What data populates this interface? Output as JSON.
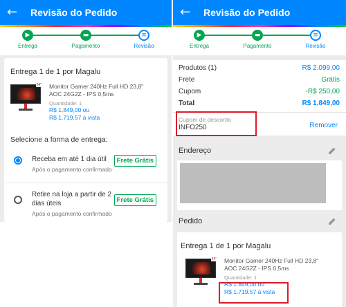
{
  "left": {
    "appbar": {
      "back": "←",
      "title": "Revisão do Pedido"
    },
    "steps": [
      {
        "label": "Entrega",
        "icon": "truck-icon",
        "status": "done"
      },
      {
        "label": "Pagamento",
        "icon": "payment-icon",
        "status": "done"
      },
      {
        "label": "Revisão",
        "icon": "review-icon",
        "status": "current"
      }
    ],
    "delivery_title": "Entrega 1 de 1 por Magalu",
    "product": {
      "name_line1": "Monitor Gamer 240Hz Full HD 23,8\"",
      "name_line2": "AOC 24G2Z - IPS 0,5ms",
      "quantity": "Quantidade: 1",
      "price_installment": "R$ 1.849,00 ou",
      "price_cash": "R$ 1.719,57 à vista"
    },
    "shipping_heading": "Selecione a forma de entrega:",
    "options": [
      {
        "title": "Receba em até 1 dia útil",
        "subtitle": "Após o pagamento confirmado",
        "tag": "Frete Grátis",
        "selected": true
      },
      {
        "title_line1": "Retire na loja a partir de 2",
        "title_line2": "dias úteis",
        "subtitle": "Após o pagamento confirmado",
        "tag": "Frete Grátis",
        "selected": false
      }
    ]
  },
  "right": {
    "appbar": {
      "back": "←",
      "title": "Revisão do Pedido"
    },
    "steps": [
      {
        "label": "Entrega",
        "icon": "truck-icon",
        "status": "done"
      },
      {
        "label": "Pagamento",
        "icon": "payment-icon",
        "status": "done"
      },
      {
        "label": "Revisão",
        "icon": "review-icon",
        "status": "current"
      }
    ],
    "summary": {
      "products_label": "Produtos (1)",
      "products_value": "R$ 2.099,00",
      "shipping_label": "Frete",
      "shipping_value": "Grátis",
      "coupon_label": "Cupom",
      "coupon_value": "-R$ 250,00",
      "total_label": "Total",
      "total_value": "R$ 1.849,00"
    },
    "coupon": {
      "field_label": "Cupom de desconto",
      "code": "INFO250",
      "remove": "Remover"
    },
    "address": {
      "heading": "Endereço"
    },
    "order": {
      "heading": "Pedido"
    },
    "delivery_title": "Entrega 1 de 1 por Magalu",
    "product": {
      "name_line1": "Monitor Gamer 240Hz Full HD 23,8\"",
      "name_line2": "AOC 24G2Z - IPS 0,5ms",
      "quantity": "Quantidade: 1",
      "price_installment": "R$ 1.849,00 ou",
      "price_cash": "R$ 1.719,57 à vista"
    }
  },
  "colors": {
    "brand_blue": "#0086ff",
    "success_green": "#00a650",
    "highlight_red": "#e0182d"
  }
}
